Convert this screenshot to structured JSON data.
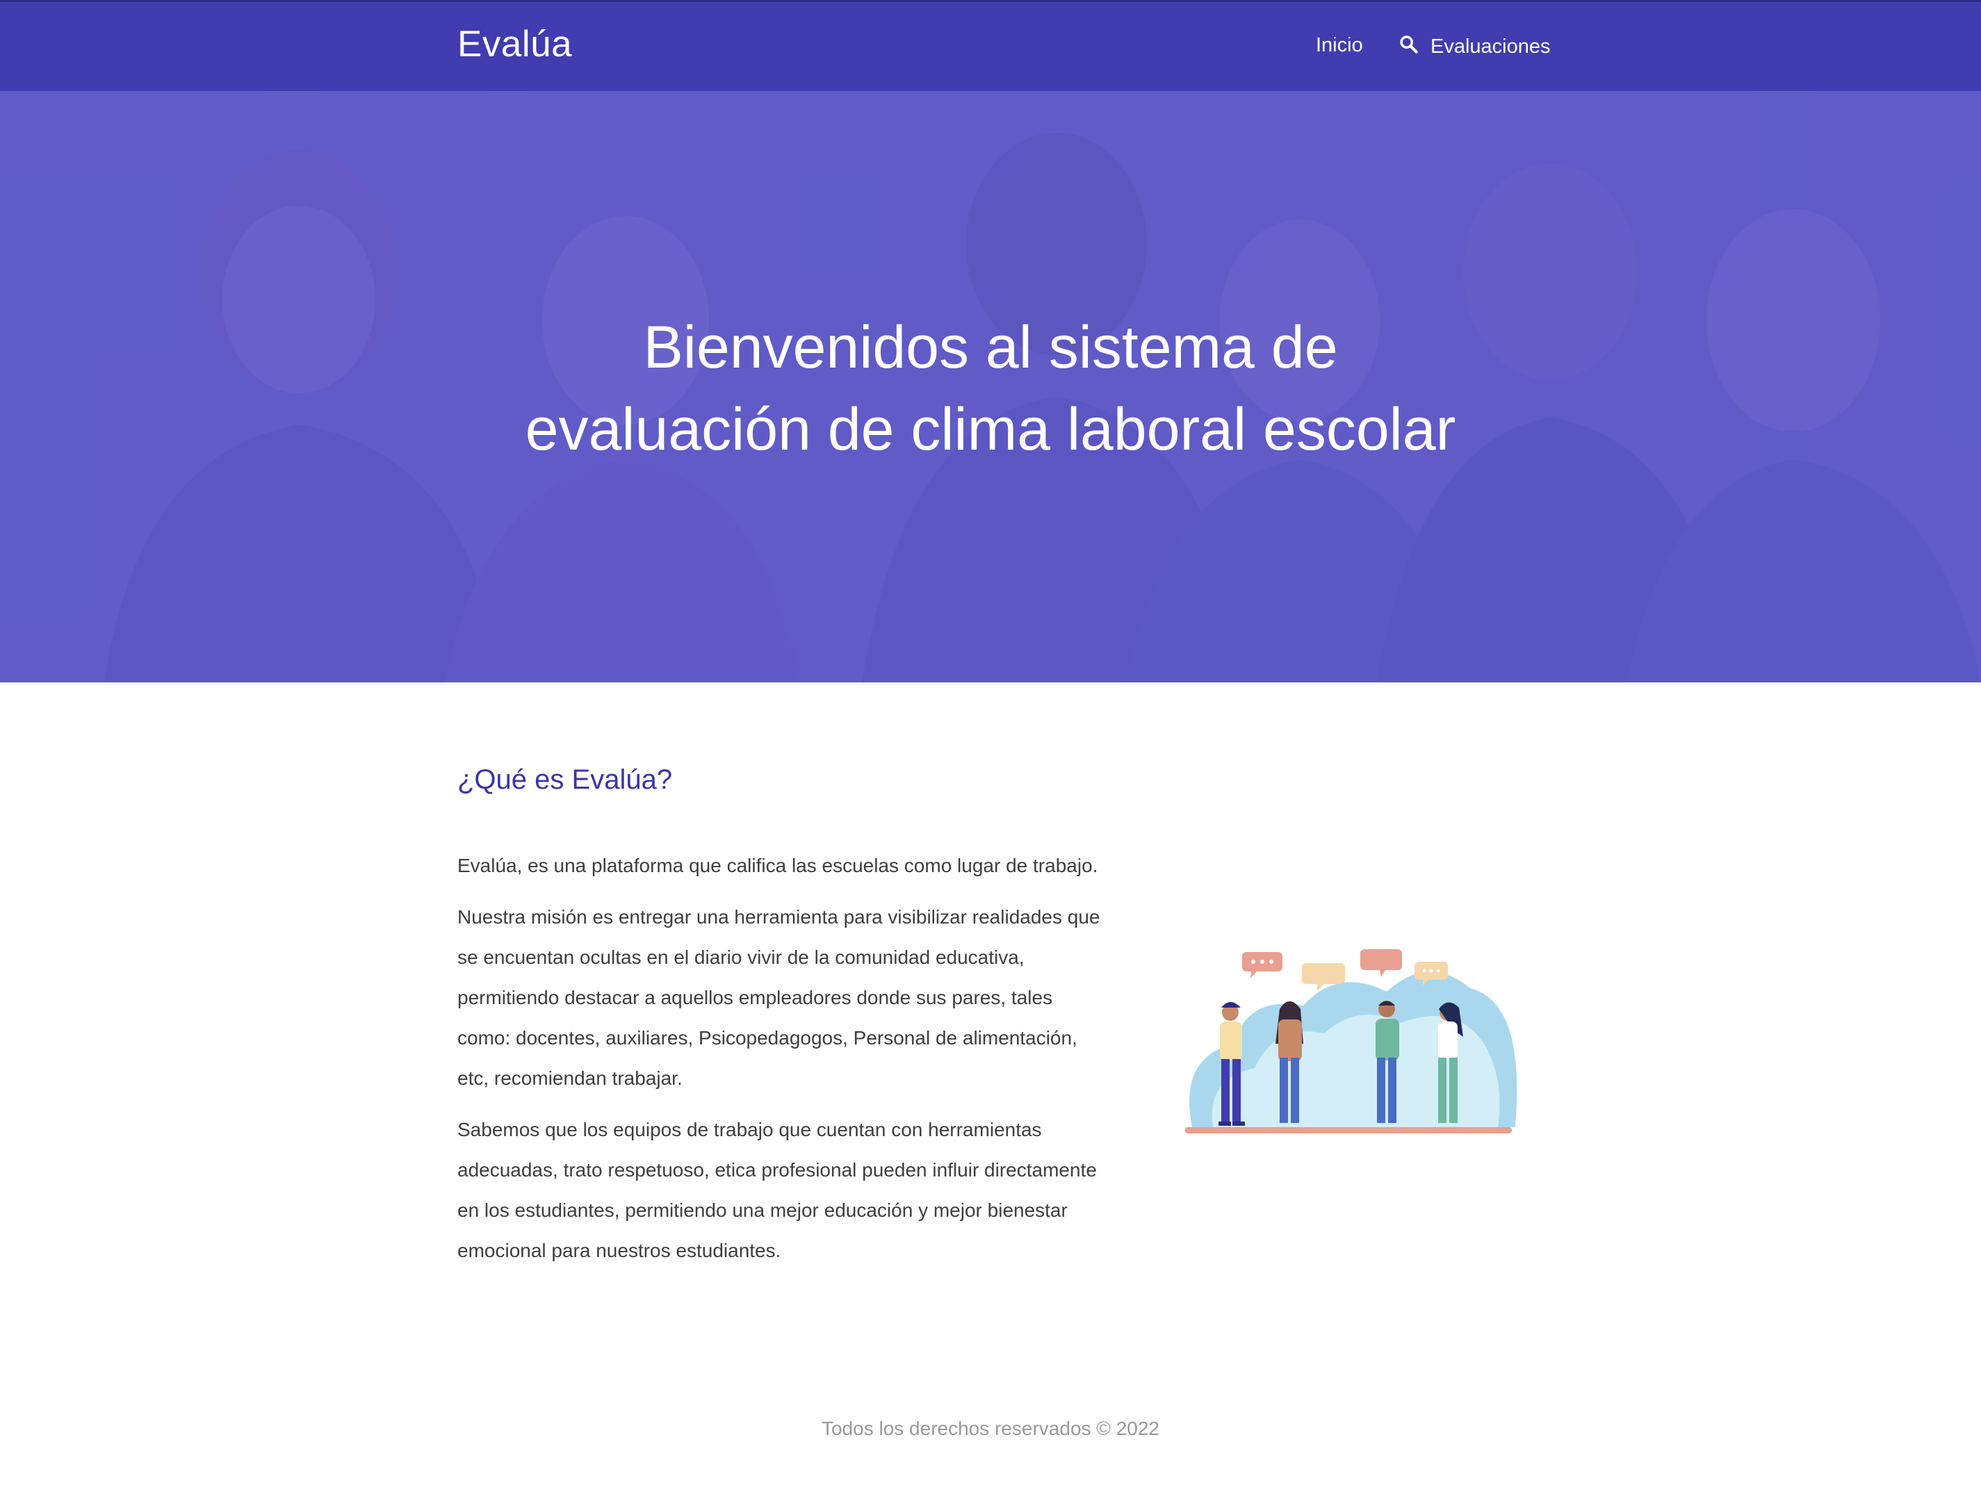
{
  "colors": {
    "brand_primary": "#413caf",
    "heading": "#3a35a8",
    "body_text": "#3e3e3e",
    "footer_text": "#999999"
  },
  "header": {
    "brand": "Evalúa",
    "nav": [
      {
        "label": "Inicio",
        "icon": null
      },
      {
        "label": "Evaluaciones",
        "icon": "search-icon"
      }
    ]
  },
  "hero": {
    "title_line1": "Bienvenidos al sistema de",
    "title_line2": "evaluación de clima laboral escolar"
  },
  "about": {
    "heading": "¿Qué es Evalúa?",
    "paragraphs": [
      "Evalúa, es una plataforma que califica las escuelas como lugar de trabajo.",
      "Nuestra misión es entregar una herramienta para visibilizar realidades que se encuentan ocultas en el diario vivir de la comunidad educativa, permitiendo destacar a aquellos empleadores donde sus pares, tales como: docentes, auxiliares, Psicopedagogos, Personal de alimentación, etc, recomiendan trabajar.",
      "Sabemos que los equipos de trabajo que cuentan con herramientas adecuadas, trato respetuoso, etica profesional pueden influir directamente en los estudiantes, permitiendo una mejor educación y mejor bienestar emocional para nuestros estudiantes."
    ]
  },
  "footer": {
    "text": "Todos los derechos reservados © 2022"
  }
}
